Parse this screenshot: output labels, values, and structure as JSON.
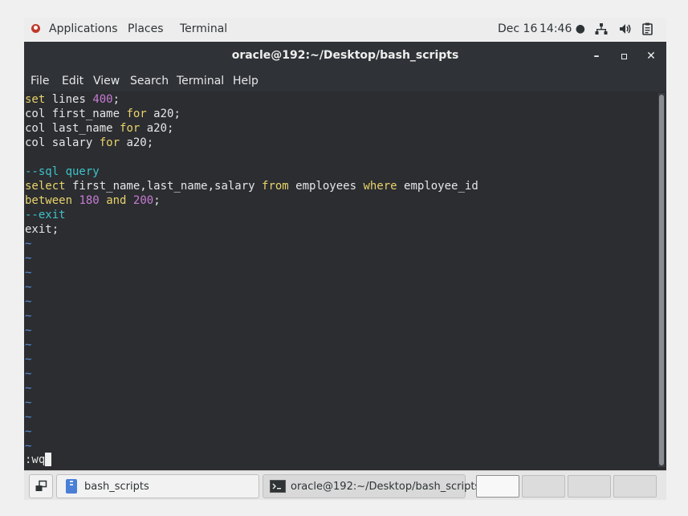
{
  "topbar": {
    "applications": "Applications",
    "places": "Places",
    "terminal": "Terminal",
    "date": "Dec 16",
    "time": "14:46 ●"
  },
  "window": {
    "title": "oracle@192:~/Desktop/bash_scripts",
    "menu": [
      "File",
      "Edit",
      "View",
      "Search",
      "Terminal",
      "Help"
    ]
  },
  "editor": {
    "code": [
      [
        {
          "t": "set",
          "c": "kw"
        },
        {
          "t": " lines "
        },
        {
          "t": "400",
          "c": "num"
        },
        {
          "t": ";"
        }
      ],
      [
        {
          "t": "col first_name "
        },
        {
          "t": "for",
          "c": "kw"
        },
        {
          "t": " a20;"
        }
      ],
      [
        {
          "t": "col last_name "
        },
        {
          "t": "for",
          "c": "kw"
        },
        {
          "t": " a20;"
        }
      ],
      [
        {
          "t": "col salary "
        },
        {
          "t": "for",
          "c": "kw"
        },
        {
          "t": " a20;"
        }
      ],
      [],
      [
        {
          "t": "--sql query",
          "c": "cmt"
        }
      ],
      [
        {
          "t": "select",
          "c": "kw"
        },
        {
          "t": " first_name,last_name,salary "
        },
        {
          "t": "from",
          "c": "kw"
        },
        {
          "t": " employees "
        },
        {
          "t": "where",
          "c": "kw"
        },
        {
          "t": " employee_id"
        }
      ],
      [
        {
          "t": "between",
          "c": "kw"
        },
        {
          "t": " "
        },
        {
          "t": "180",
          "c": "num"
        },
        {
          "t": " "
        },
        {
          "t": "and",
          "c": "kw"
        },
        {
          "t": " "
        },
        {
          "t": "200",
          "c": "num"
        },
        {
          "t": ";"
        }
      ],
      [
        {
          "t": "--exit",
          "c": "cmt"
        }
      ],
      [
        {
          "t": "exit;"
        }
      ]
    ],
    "tilde_count": 15,
    "tilde_char": "~",
    "command": ":wq"
  },
  "taskbar": {
    "file_manager": "bash_scripts",
    "terminal": "oracle@192:~/Desktop/bash_scripts"
  },
  "colors": {
    "keyword": "#e9d36a",
    "number": "#c77bd3",
    "comment": "#3ec2c7",
    "tilde": "#5a8fd6",
    "background": "#2b2d31"
  }
}
